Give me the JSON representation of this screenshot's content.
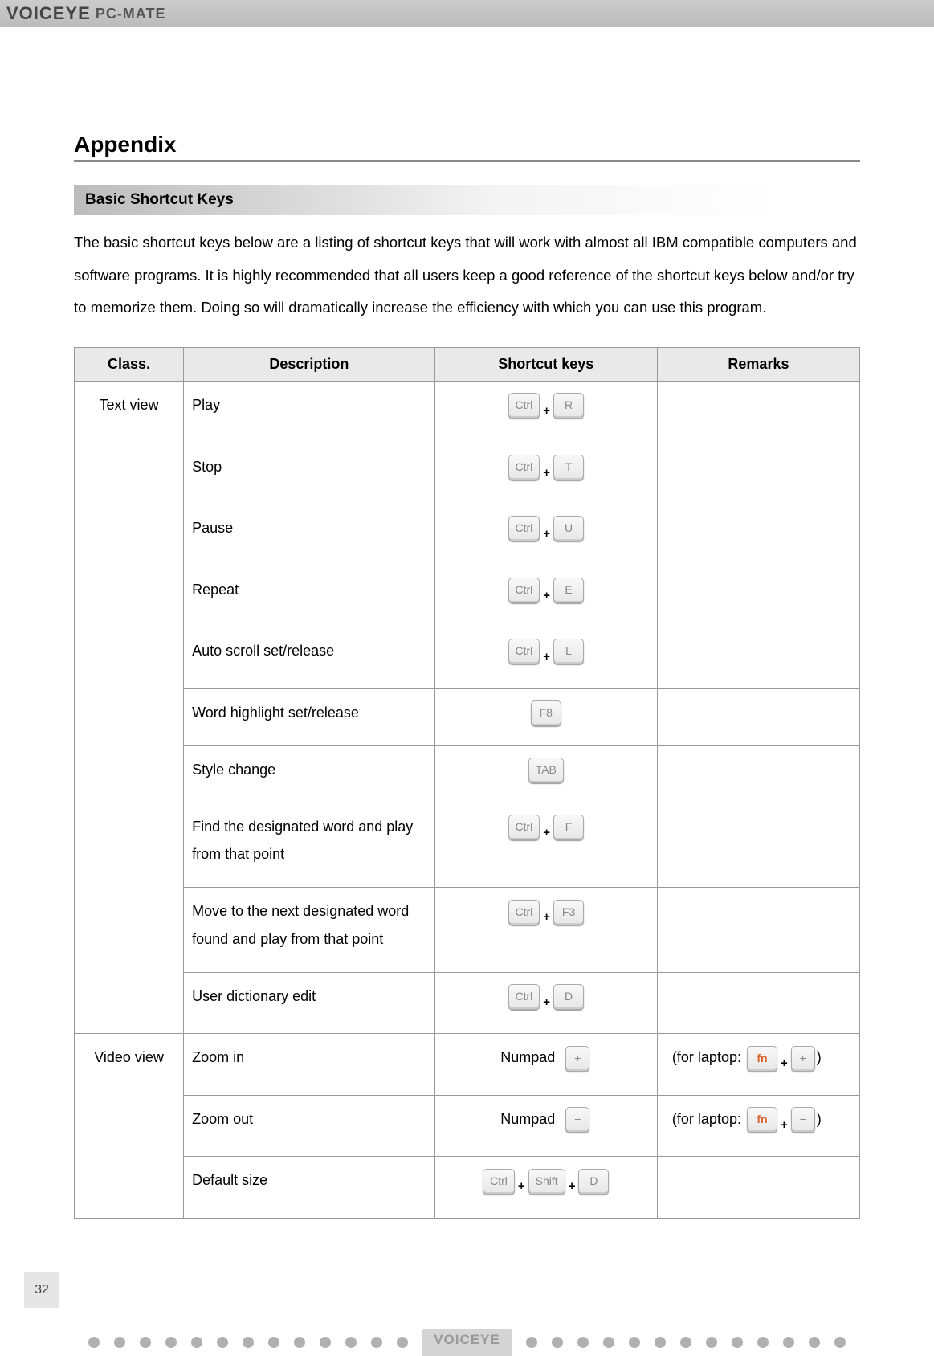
{
  "header": {
    "logo_main": "VOICEYE",
    "logo_sub": "PC-MATE"
  },
  "page_title": "Appendix",
  "section_title": "Basic Shortcut Keys",
  "intro_text": "The basic shortcut keys below are a listing of shortcut keys that will work with almost all IBM compatible computers and software programs. It is highly recommended that all users keep a good reference of the shortcut keys below and/or try to memorize them. Doing so will dramatically increase the efficiency with which you can use this program.",
  "table": {
    "headers": {
      "class": "Class.",
      "desc": "Description",
      "shortcut": "Shortcut keys",
      "remarks": "Remarks"
    },
    "classes": {
      "text": "Text view",
      "video": "Video view"
    },
    "rows": [
      {
        "class": "text",
        "desc": "Play",
        "keys": [
          [
            "Ctrl",
            "+",
            "R"
          ]
        ],
        "remarks": ""
      },
      {
        "class": "text",
        "desc": "Stop",
        "keys": [
          [
            "Ctrl",
            "+",
            "T"
          ]
        ],
        "remarks": ""
      },
      {
        "class": "text",
        "desc": "Pause",
        "keys": [
          [
            "Ctrl",
            "+",
            "U"
          ]
        ],
        "remarks": ""
      },
      {
        "class": "text",
        "desc": "Repeat",
        "keys": [
          [
            "Ctrl",
            "+",
            "E"
          ]
        ],
        "remarks": ""
      },
      {
        "class": "text",
        "desc": "Auto scroll set/release",
        "keys": [
          [
            "Ctrl",
            "+",
            "L"
          ]
        ],
        "remarks": ""
      },
      {
        "class": "text",
        "desc": "Word highlight set/release",
        "keys": [
          [
            "F8"
          ]
        ],
        "remarks": ""
      },
      {
        "class": "text",
        "desc": "Style change",
        "keys": [
          [
            "TAB"
          ]
        ],
        "remarks": ""
      },
      {
        "class": "text",
        "desc": "Find the designated word and play from that point",
        "keys": [
          [
            "Ctrl",
            "+",
            "F"
          ]
        ],
        "remarks": ""
      },
      {
        "class": "text",
        "desc": "Move to the next designated word found and play from that point",
        "keys": [
          [
            "Ctrl",
            "+",
            "F3"
          ]
        ],
        "remarks": ""
      },
      {
        "class": "text",
        "desc": "User dictionary edit",
        "keys": [
          [
            "Ctrl",
            "+",
            "D"
          ]
        ],
        "remarks": ""
      },
      {
        "class": "video",
        "desc": "Zoom in",
        "numpad": "Numpad",
        "numpad_key": "plus",
        "remarks_prefix": "(for laptop: ",
        "remarks_keys": [
          "fn",
          "+",
          "plus"
        ],
        "remarks_suffix": ")"
      },
      {
        "class": "video",
        "desc": "Zoom out",
        "numpad": "Numpad",
        "numpad_key": "minus",
        "remarks_prefix": "(for laptop: ",
        "remarks_keys": [
          "fn",
          "+",
          "minus"
        ],
        "remarks_suffix": ")"
      },
      {
        "class": "video",
        "desc": "Default size",
        "keys": [
          [
            "Ctrl",
            "+",
            "Shift",
            "+",
            "D"
          ]
        ],
        "remarks": ""
      }
    ]
  },
  "page_number": "32",
  "footer_brand": "VOICEYE"
}
